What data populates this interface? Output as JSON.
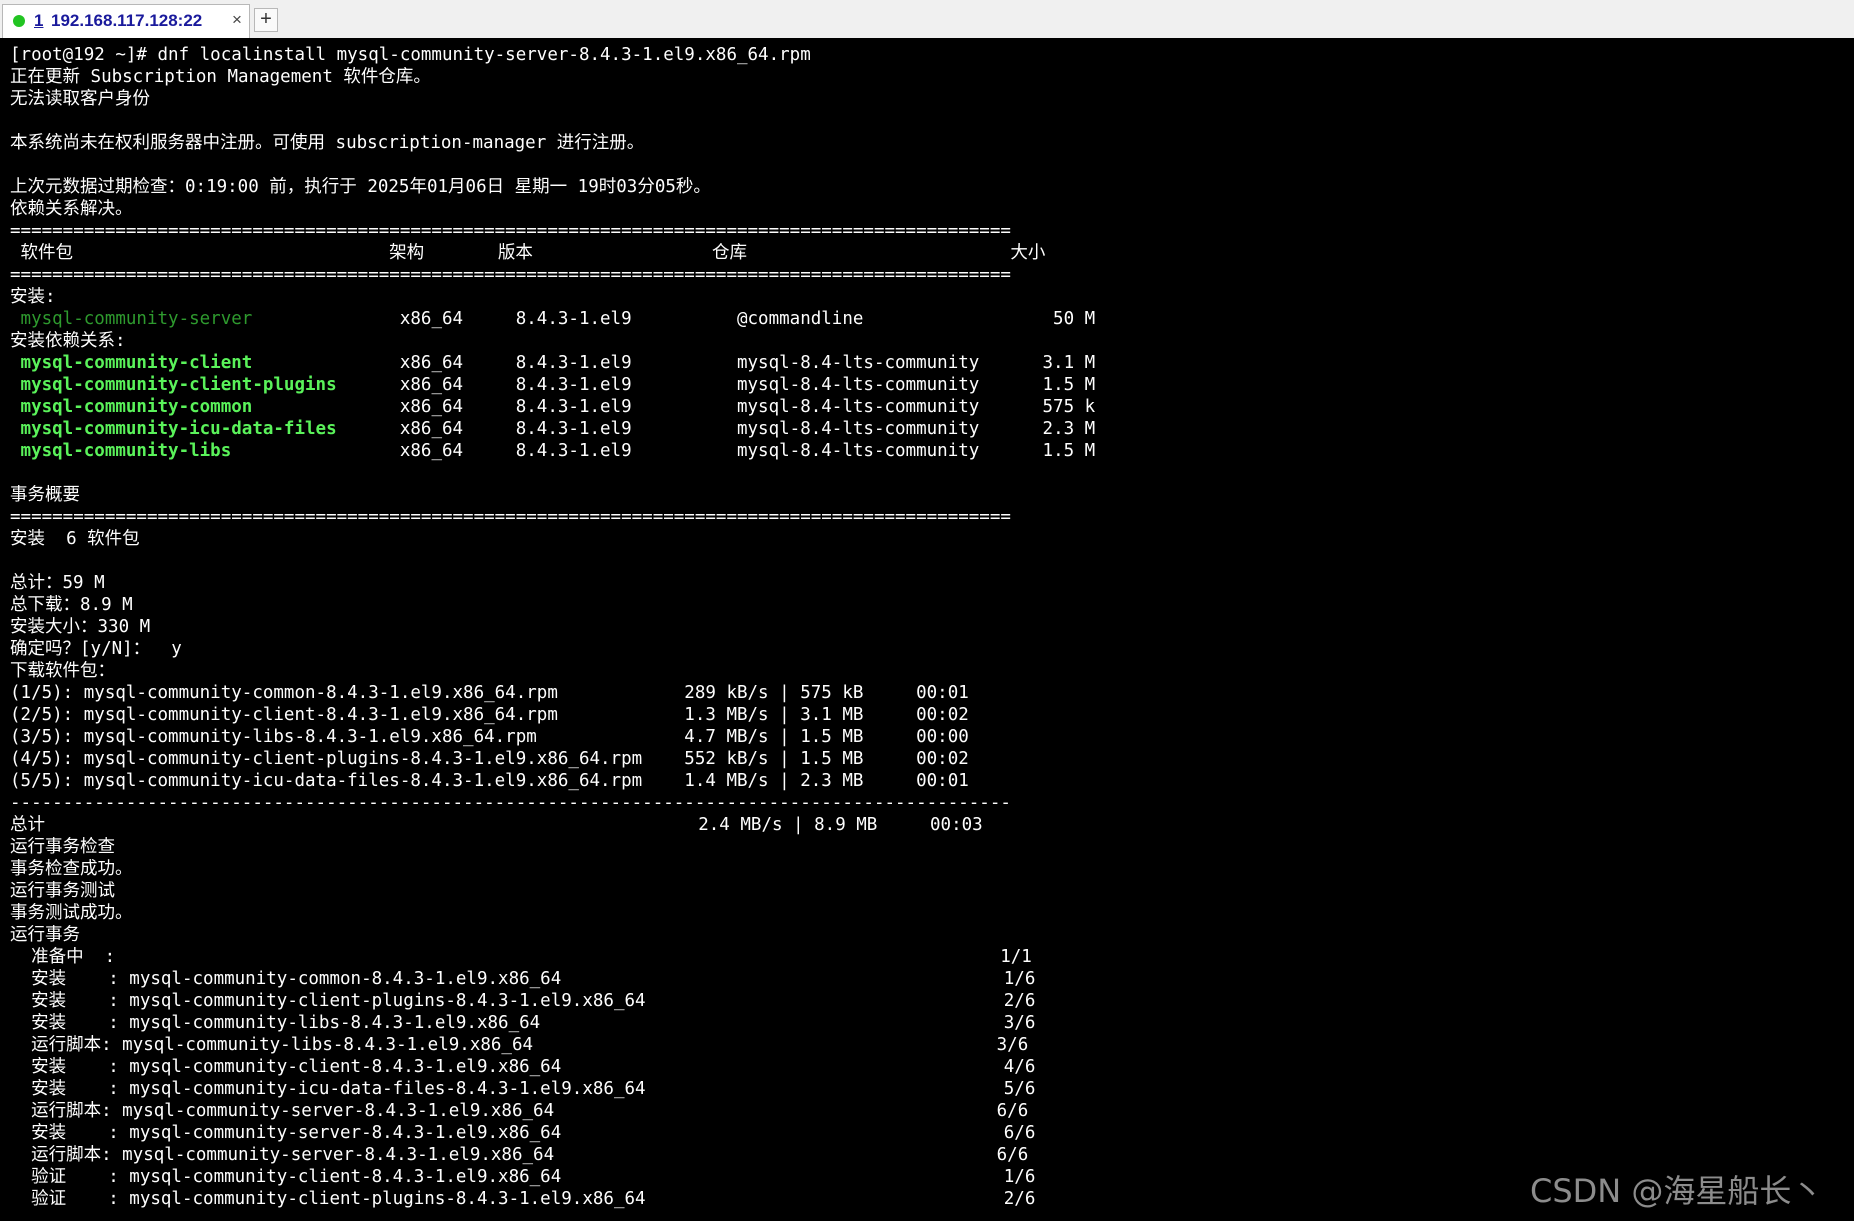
{
  "tab": {
    "status_color": "#22c422",
    "number": "1",
    "title": "192.168.117.128:22",
    "close_glyph": "×",
    "new_tab_glyph": "+"
  },
  "terminal": {
    "lines": [
      {
        "text": "[root@192 ~]# dnf localinstall mysql-community-server-8.4.3-1.el9.x86_64.rpm",
        "style": "normal"
      },
      {
        "text": "正在更新 Subscription Management 软件仓库。",
        "style": "normal"
      },
      {
        "text": "无法读取客户身份",
        "style": "normal"
      },
      {
        "text": "",
        "style": "normal"
      },
      {
        "text": "本系统尚未在权利服务器中注册。可使用 subscription-manager 进行注册。",
        "style": "normal"
      },
      {
        "text": "",
        "style": "normal"
      },
      {
        "text": "上次元数据过期检查：0:19:00 前，执行于 2025年01月06日 星期一 19时03分05秒。",
        "style": "normal"
      },
      {
        "text": "依赖关系解决。",
        "style": "normal"
      },
      {
        "text": "===============================================================================================",
        "style": "hr"
      },
      {
        "text": " 软件包                              架构       版本                 仓库                         大小",
        "style": "normal"
      },
      {
        "text": "===============================================================================================",
        "style": "hr"
      },
      {
        "text": "安装:",
        "style": "normal"
      },
      {
        "text": " mysql-community-server",
        "style": "dim-green",
        "rest": "              x86_64     8.4.3-1.el9          @commandline                  50 M"
      },
      {
        "text": "安装依赖关系:",
        "style": "normal"
      },
      {
        "text": " mysql-community-client",
        "style": "bold-green",
        "rest": "              x86_64     8.4.3-1.el9          mysql-8.4-lts-community      3.1 M"
      },
      {
        "text": " mysql-community-client-plugins",
        "style": "bold-green",
        "rest": "      x86_64     8.4.3-1.el9          mysql-8.4-lts-community      1.5 M"
      },
      {
        "text": " mysql-community-common",
        "style": "bold-green",
        "rest": "              x86_64     8.4.3-1.el9          mysql-8.4-lts-community      575 k"
      },
      {
        "text": " mysql-community-icu-data-files",
        "style": "bold-green",
        "rest": "      x86_64     8.4.3-1.el9          mysql-8.4-lts-community      2.3 M"
      },
      {
        "text": " mysql-community-libs",
        "style": "bold-green",
        "rest": "                x86_64     8.4.3-1.el9          mysql-8.4-lts-community      1.5 M"
      },
      {
        "text": "",
        "style": "normal"
      },
      {
        "text": "事务概要",
        "style": "normal"
      },
      {
        "text": "===============================================================================================",
        "style": "hr"
      },
      {
        "text": "安装  6 软件包",
        "style": "normal"
      },
      {
        "text": "",
        "style": "normal"
      },
      {
        "text": "总计：59 M",
        "style": "normal"
      },
      {
        "text": "总下载：8.9 M",
        "style": "normal"
      },
      {
        "text": "安装大小：330 M",
        "style": "normal"
      },
      {
        "text": "确定吗？[y/N]：  y",
        "style": "normal"
      },
      {
        "text": "下载软件包：",
        "style": "normal"
      },
      {
        "text": "(1/5): mysql-community-common-8.4.3-1.el9.x86_64.rpm            289 kB/s | 575 kB     00:01",
        "style": "normal"
      },
      {
        "text": "(2/5): mysql-community-client-8.4.3-1.el9.x86_64.rpm            1.3 MB/s | 3.1 MB     00:02",
        "style": "normal"
      },
      {
        "text": "(3/5): mysql-community-libs-8.4.3-1.el9.x86_64.rpm              4.7 MB/s | 1.5 MB     00:00",
        "style": "normal"
      },
      {
        "text": "(4/5): mysql-community-client-plugins-8.4.3-1.el9.x86_64.rpm    552 kB/s | 1.5 MB     00:02",
        "style": "normal"
      },
      {
        "text": "(5/5): mysql-community-icu-data-files-8.4.3-1.el9.x86_64.rpm    1.4 MB/s | 2.3 MB     00:01",
        "style": "normal"
      },
      {
        "text": "-----------------------------------------------------------------------------------------------",
        "style": "hr"
      },
      {
        "text": "总计                                                              2.4 MB/s | 8.9 MB     00:03",
        "style": "normal"
      },
      {
        "text": "运行事务检查",
        "style": "normal"
      },
      {
        "text": "事务检查成功。",
        "style": "normal"
      },
      {
        "text": "运行事务测试",
        "style": "normal"
      },
      {
        "text": "事务测试成功。",
        "style": "normal"
      },
      {
        "text": "运行事务",
        "style": "normal"
      },
      {
        "text": "  准备中  :                                                                                    1/1",
        "style": "normal"
      },
      {
        "text": "  安装    : mysql-community-common-8.4.3-1.el9.x86_64                                          1/6",
        "style": "normal"
      },
      {
        "text": "  安装    : mysql-community-client-plugins-8.4.3-1.el9.x86_64                                  2/6",
        "style": "normal"
      },
      {
        "text": "  安装    : mysql-community-libs-8.4.3-1.el9.x86_64                                            3/6",
        "style": "normal"
      },
      {
        "text": "  运行脚本: mysql-community-libs-8.4.3-1.el9.x86_64                                            3/6",
        "style": "normal"
      },
      {
        "text": "  安装    : mysql-community-client-8.4.3-1.el9.x86_64                                          4/6",
        "style": "normal"
      },
      {
        "text": "  安装    : mysql-community-icu-data-files-8.4.3-1.el9.x86_64                                  5/6",
        "style": "normal"
      },
      {
        "text": "  运行脚本: mysql-community-server-8.4.3-1.el9.x86_64                                          6/6",
        "style": "normal"
      },
      {
        "text": "  安装    : mysql-community-server-8.4.3-1.el9.x86_64                                          6/6",
        "style": "normal"
      },
      {
        "text": "  运行脚本: mysql-community-server-8.4.3-1.el9.x86_64                                          6/6",
        "style": "normal"
      },
      {
        "text": "  验证    : mysql-community-client-8.4.3-1.el9.x86_64                                          1/6",
        "style": "normal"
      },
      {
        "text": "  验证    : mysql-community-client-plugins-8.4.3-1.el9.x86_64                                  2/6",
        "style": "normal"
      }
    ]
  },
  "watermark": "CSDN @海星船长丶"
}
